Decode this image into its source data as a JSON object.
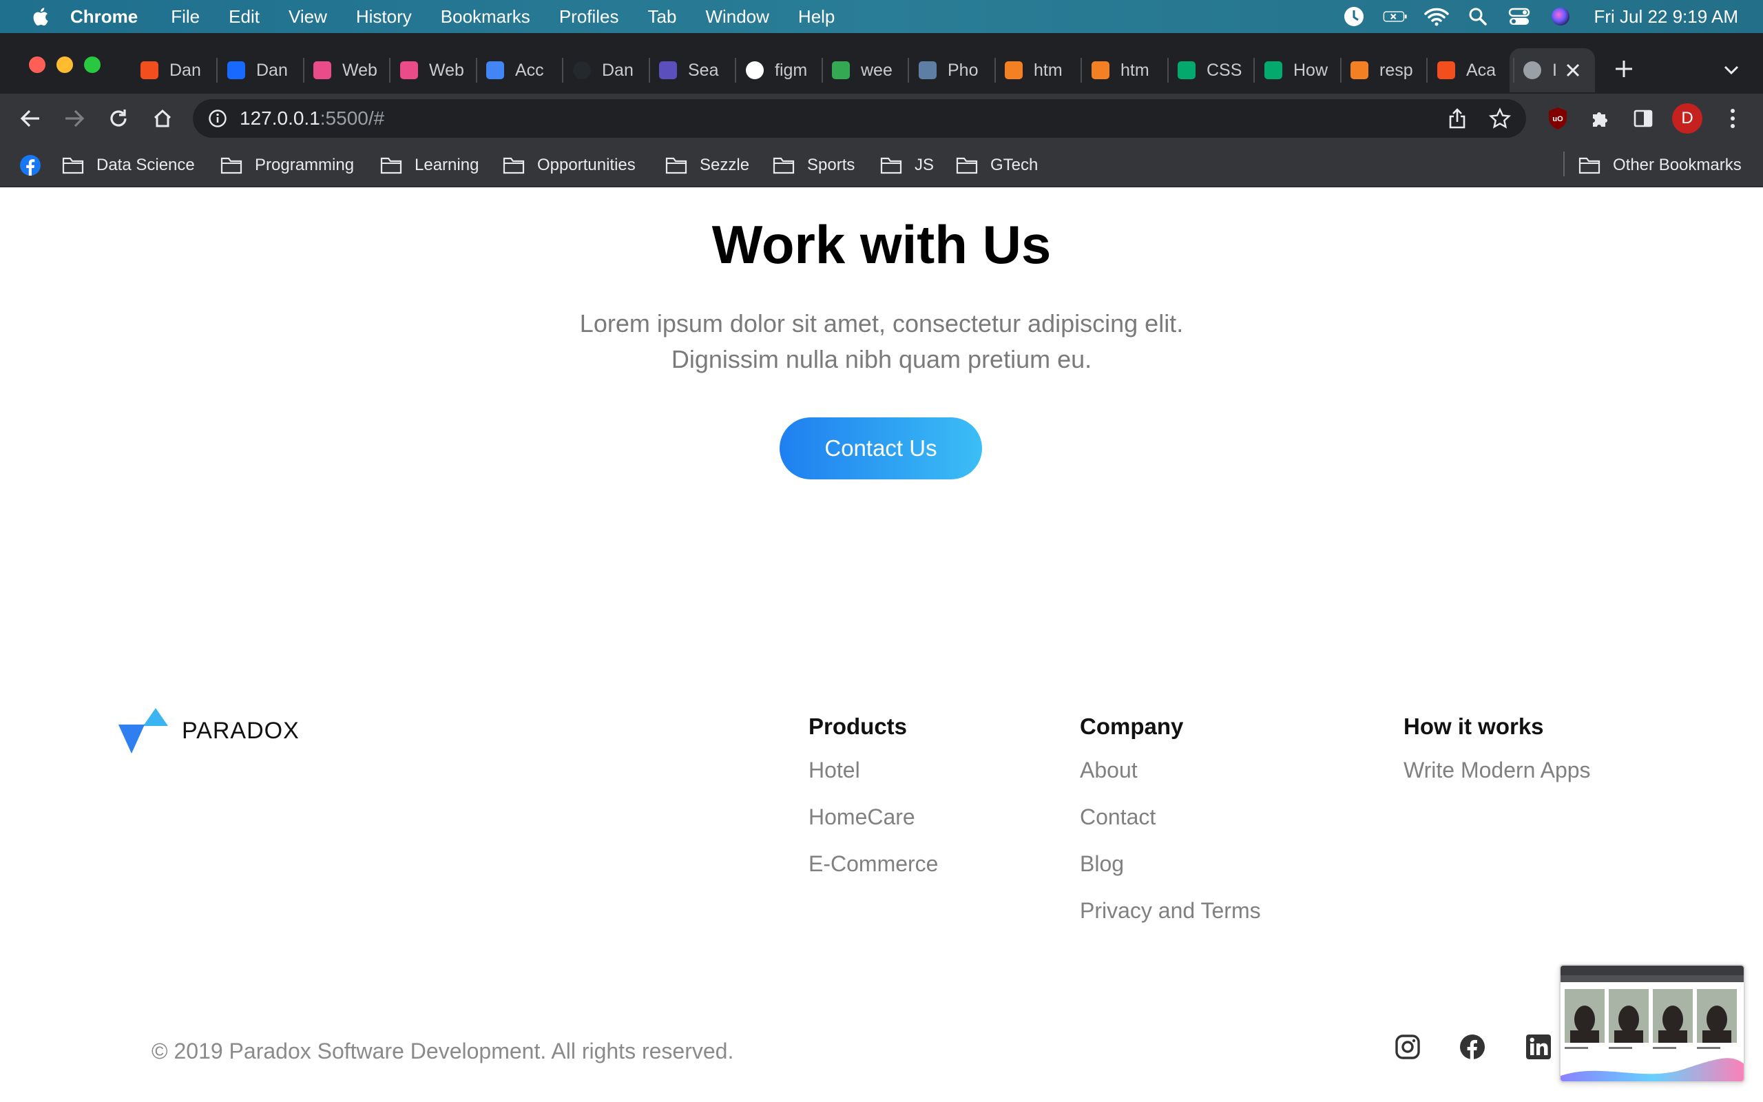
{
  "menubar": {
    "app": "Chrome",
    "items": [
      "File",
      "Edit",
      "View",
      "History",
      "Bookmarks",
      "Profiles",
      "Tab",
      "Window",
      "Help"
    ],
    "clock": "Fri Jul 22  9:19 AM"
  },
  "tabs": [
    {
      "label": "Dan",
      "icon": "figma-icon",
      "color": "#f24e1e"
    },
    {
      "label": "Dan",
      "icon": "behance-icon",
      "color": "#1769ff"
    },
    {
      "label": "Web",
      "icon": "dribbble-icon",
      "color": "#ea4c89"
    },
    {
      "label": "Web",
      "icon": "dribbble-icon",
      "color": "#ea4c89"
    },
    {
      "label": "Acc",
      "icon": "docs-icon",
      "color": "#4285f4"
    },
    {
      "label": "Dan",
      "icon": "github-icon",
      "color": "#24292e"
    },
    {
      "label": "Sea",
      "icon": "search-logo-icon",
      "color": "#5b4fbd"
    },
    {
      "label": "figm",
      "icon": "google-icon",
      "color": "#ffffff"
    },
    {
      "label": "wee",
      "icon": "drive-icon",
      "color": "#34a853"
    },
    {
      "label": "Pho",
      "icon": "repo-icon",
      "color": "#5f7ea3"
    },
    {
      "label": "htm",
      "icon": "stackoverflow-icon",
      "color": "#f48024"
    },
    {
      "label": "htm",
      "icon": "stackoverflow-icon",
      "color": "#f48024"
    },
    {
      "label": "CSS",
      "icon": "w3-icon",
      "color": "#04aa6d"
    },
    {
      "label": "How",
      "icon": "w3-icon",
      "color": "#04aa6d"
    },
    {
      "label": "resp",
      "icon": "stackoverflow-icon",
      "color": "#f48024"
    },
    {
      "label": "Aca",
      "icon": "figma-icon",
      "color": "#f24e1e"
    },
    {
      "label": "I",
      "icon": "globe-icon",
      "color": "#9aa0a6"
    }
  ],
  "address": {
    "host": "127.0.0.1",
    "rest": ":5500/#"
  },
  "profile_initial": "D",
  "bookmarks": [
    "Data Science",
    "Programming",
    "Learning",
    "Opportunities",
    "Sezzle",
    "Sports",
    "JS",
    "GTech"
  ],
  "other_bookmarks": "Other Bookmarks",
  "hero": {
    "title": "Work with Us",
    "subtitle_line1": "Lorem ipsum dolor sit amet, consectetur adipiscing elit.",
    "subtitle_line2": "Dignissim nulla nibh quam pretium eu.",
    "cta": "Contact Us"
  },
  "footer": {
    "brand": "PARADOX",
    "columns": [
      {
        "title": "Products",
        "links": [
          "Hotel",
          "HomeCare",
          "E-Commerce"
        ]
      },
      {
        "title": "Company",
        "links": [
          "About",
          "Contact",
          "Blog",
          "Privacy and Terms"
        ]
      },
      {
        "title": "How it works",
        "links": [
          "Write Modern Apps"
        ]
      }
    ],
    "copyright": "© 2019 Paradox Software Development. All rights reserved.",
    "social": [
      "instagram-icon",
      "facebook-icon",
      "linkedin-icon"
    ]
  },
  "colors": {
    "accent_start": "#1f7ff0",
    "accent_end": "#3bbef5",
    "logo_blue": "#2f8ff0"
  }
}
